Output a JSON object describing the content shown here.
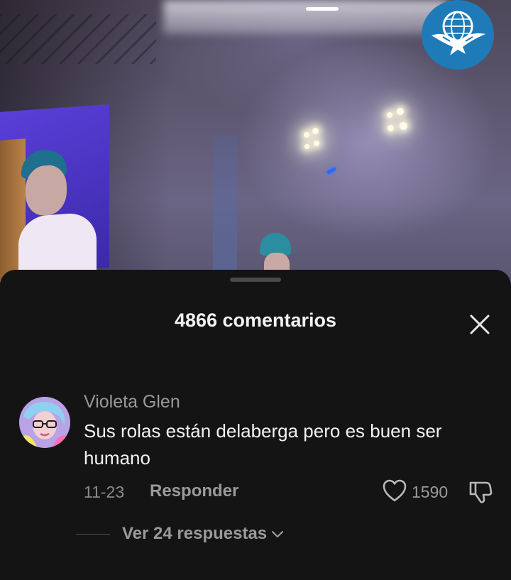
{
  "colors": {
    "sheet_background": "#141414",
    "title_text": "#f2f2f2",
    "muted_text": "#9a9a9a",
    "logo_blue": "#1e7bb8"
  },
  "video": {
    "logo_icon": "eagle-globe-logo-icon"
  },
  "comments_sheet": {
    "title": "4866 comentarios",
    "close_icon": "close-icon",
    "comments": [
      {
        "author": "Violeta Glen",
        "text": "Sus rolas están delaberga pero es buen ser humano",
        "date": "11-23",
        "reply_label": "Responder",
        "like_count": "1590",
        "like_icon": "heart-icon",
        "dislike_icon": "thumbs-down-icon",
        "view_replies_label": "Ver 24 respuestas"
      }
    ]
  }
}
